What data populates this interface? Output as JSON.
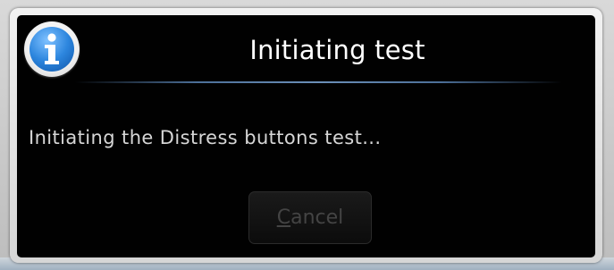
{
  "dialog": {
    "title": "Initiating test",
    "message": "Initiating the Distress buttons test...",
    "cancel_button": {
      "mnemonic": "C",
      "rest": "ancel",
      "enabled": false
    }
  },
  "icons": {
    "dialog_icon": "info-icon"
  },
  "colors": {
    "dialog_background": "#010101",
    "title_text": "#ffffff",
    "message_text": "#d6d6d6",
    "button_text_disabled": "#444444",
    "divider": "#6b8fb8",
    "icon_blue": "#2d86de"
  }
}
